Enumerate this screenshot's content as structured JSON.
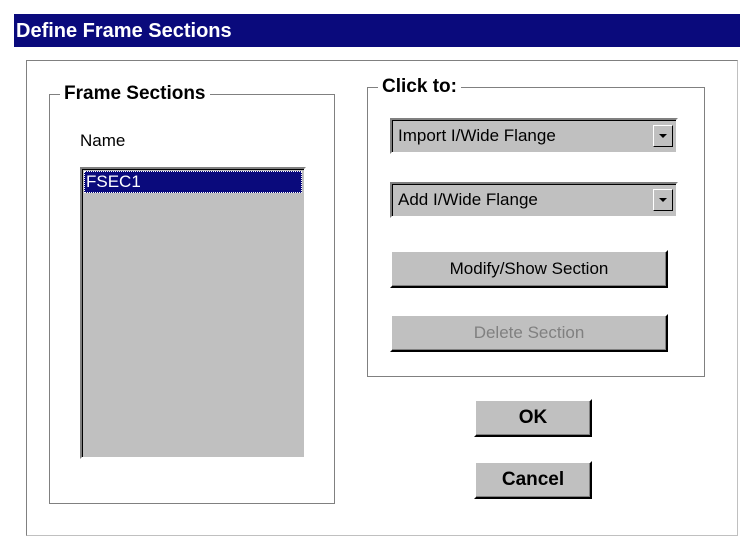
{
  "window": {
    "title": "Define Frame Sections"
  },
  "frame_sections": {
    "group_label": "Frame Sections",
    "name_label": "Name",
    "items": [
      "FSEC1"
    ],
    "selected": "FSEC1"
  },
  "click_to": {
    "group_label": "Click to:",
    "import_combo": "Import I/Wide Flange",
    "add_combo": "Add I/Wide Flange",
    "modify_button": "Modify/Show Section",
    "delete_button": "Delete Section"
  },
  "buttons": {
    "ok": "OK",
    "cancel": "Cancel"
  },
  "colors": {
    "title_bar": "#0a0a7c",
    "selection": "#0a0a7c",
    "face": "#c0c0c0"
  }
}
